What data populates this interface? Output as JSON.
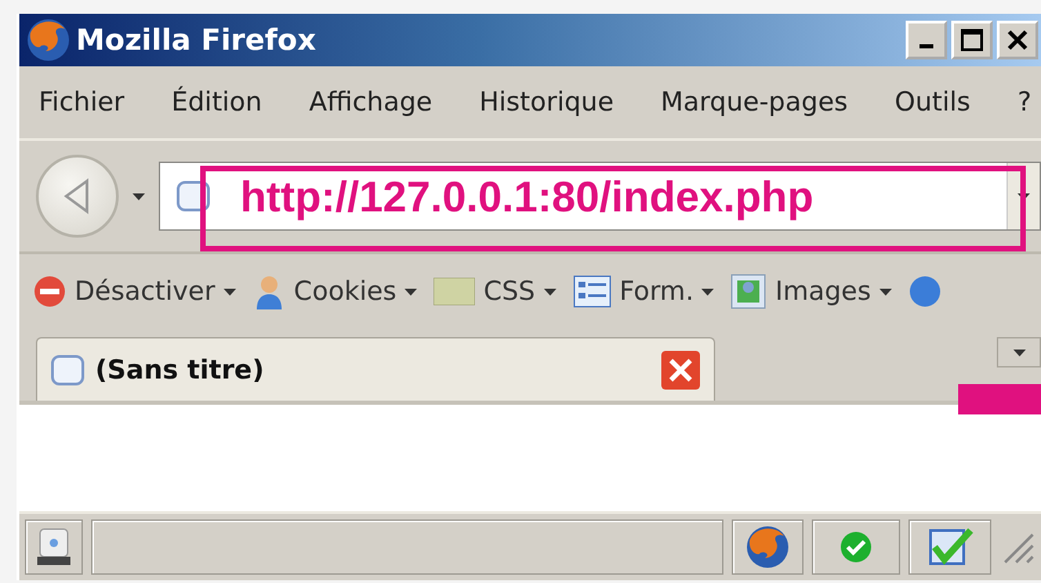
{
  "window": {
    "title": "Mozilla Firefox"
  },
  "menu": [
    {
      "label": "Fichier"
    },
    {
      "label": "Édition"
    },
    {
      "label": "Affichage"
    },
    {
      "label": "Historique"
    },
    {
      "label": "Marque-pages"
    },
    {
      "label": "Outils"
    },
    {
      "label": "?"
    }
  ],
  "address_bar": {
    "value": "http://127.0.0.1:80/index.php"
  },
  "developer_toolbar": [
    {
      "label": "Désactiver"
    },
    {
      "label": "Cookies"
    },
    {
      "label": "CSS"
    },
    {
      "label": "Form."
    },
    {
      "label": "Images"
    }
  ],
  "tabs": [
    {
      "label": "(Sans titre)",
      "selected": true
    }
  ]
}
